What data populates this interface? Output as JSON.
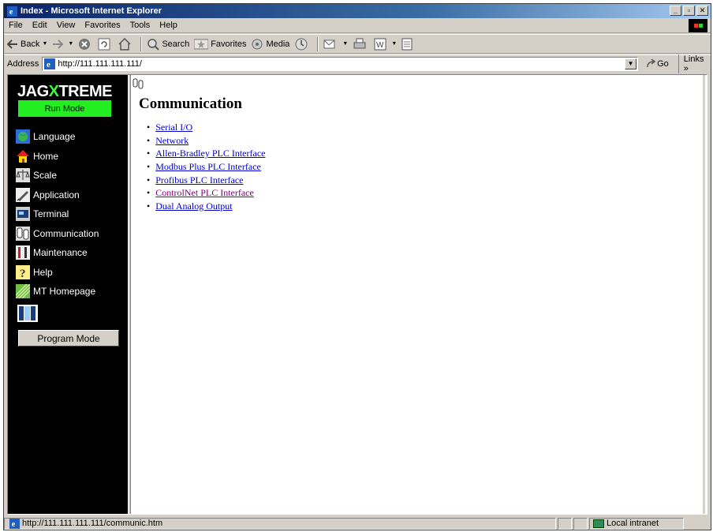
{
  "window": {
    "title": "Index - Microsoft Internet Explorer"
  },
  "menu": [
    "File",
    "Edit",
    "View",
    "Favorites",
    "Tools",
    "Help"
  ],
  "toolbar": {
    "back_label": "Back",
    "search_label": "Search",
    "favorites_label": "Favorites",
    "media_label": "Media"
  },
  "address": {
    "label": "Address",
    "url": "http://111.111.111.111/",
    "go_label": "Go",
    "links_label": "Links"
  },
  "sidebar": {
    "brand_prefix": "JAG",
    "brand_suffix": "TREME",
    "run_mode": "Run Mode",
    "items": [
      {
        "label": "Language",
        "icon": "globe-icon"
      },
      {
        "label": "Home",
        "icon": "home-icon"
      },
      {
        "label": "Scale",
        "icon": "scale-icon"
      },
      {
        "label": "Application",
        "icon": "application-icon"
      },
      {
        "label": "Terminal",
        "icon": "terminal-icon"
      },
      {
        "label": "Communication",
        "icon": "communication-icon"
      },
      {
        "label": "Maintenance",
        "icon": "maintenance-icon"
      },
      {
        "label": "Help",
        "icon": "help-icon"
      },
      {
        "label": "MT Homepage",
        "icon": "mt-homepage-icon"
      }
    ],
    "program_mode": "Program Mode"
  },
  "main": {
    "title": "Communication",
    "links": [
      {
        "label": "Serial I/O",
        "visited": false
      },
      {
        "label": "Network",
        "visited": false
      },
      {
        "label": "Allen-Bradley PLC Interface",
        "visited": false
      },
      {
        "label": "Modbus Plus PLC Interface",
        "visited": false
      },
      {
        "label": "Profibus PLC Interface",
        "visited": false
      },
      {
        "label": "ControlNet PLC Interface",
        "visited": true
      },
      {
        "label": "Dual Analog Output",
        "visited": false
      }
    ]
  },
  "status": {
    "url": "http://111.111.111.111/communic.htm",
    "zone": "Local intranet"
  },
  "colors": {
    "titlebar_start": "#0a246a",
    "run_mode_green": "#22ee22",
    "link_blue": "#0000cc",
    "link_visited": "#800080",
    "sidebar_bg": "#000000"
  }
}
